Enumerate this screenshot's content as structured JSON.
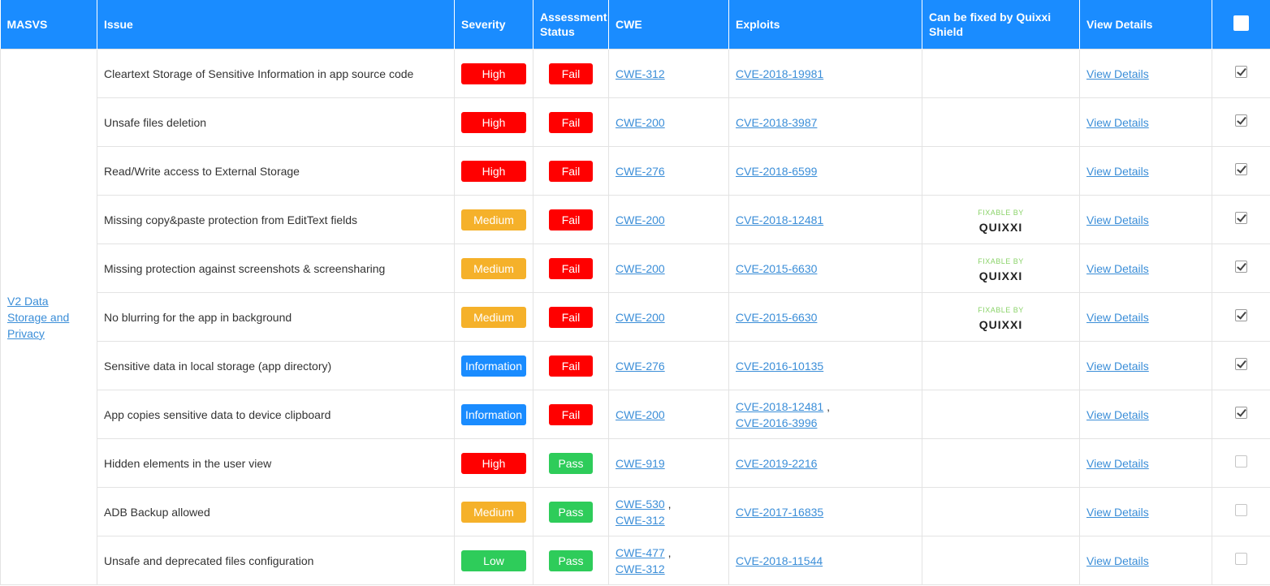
{
  "headers": {
    "masvs": "MASVS",
    "issue": "Issue",
    "severity": "Severity",
    "assessment_status": "Assessment Status",
    "cwe": "CWE",
    "exploits": "Exploits",
    "fixable": "Can be fixed by Quixxi Shield",
    "view_details": "View Details"
  },
  "masvs_group": "V2 Data Storage and Privacy",
  "fixable_label": {
    "top": "FIXABLE BY",
    "brand": "QUIXXI"
  },
  "view_details_label": "View Details",
  "rows": [
    {
      "issue": "Cleartext Storage of Sensitive Information in app source code",
      "severity": "High",
      "status": "Fail",
      "cwe": [
        "CWE-312"
      ],
      "exploits": [
        "CVE-2018-19981"
      ],
      "fixable": false,
      "checked": true
    },
    {
      "issue": "Unsafe files deletion",
      "severity": "High",
      "status": "Fail",
      "cwe": [
        "CWE-200"
      ],
      "exploits": [
        "CVE-2018-3987"
      ],
      "fixable": false,
      "checked": true
    },
    {
      "issue": "Read/Write access to External Storage",
      "severity": "High",
      "status": "Fail",
      "cwe": [
        "CWE-276"
      ],
      "exploits": [
        "CVE-2018-6599"
      ],
      "fixable": false,
      "checked": true
    },
    {
      "issue": "Missing copy&paste protection from EditText fields",
      "severity": "Medium",
      "status": "Fail",
      "cwe": [
        "CWE-200"
      ],
      "exploits": [
        "CVE-2018-12481"
      ],
      "fixable": true,
      "checked": true
    },
    {
      "issue": "Missing protection against screenshots & screensharing",
      "severity": "Medium",
      "status": "Fail",
      "cwe": [
        "CWE-200"
      ],
      "exploits": [
        "CVE-2015-6630"
      ],
      "fixable": true,
      "checked": true
    },
    {
      "issue": "No blurring for the app in background",
      "severity": "Medium",
      "status": "Fail",
      "cwe": [
        "CWE-200"
      ],
      "exploits": [
        "CVE-2015-6630"
      ],
      "fixable": true,
      "checked": true
    },
    {
      "issue": "Sensitive data in local storage (app directory)",
      "severity": "Information",
      "status": "Fail",
      "cwe": [
        "CWE-276"
      ],
      "exploits": [
        "CVE-2016-10135"
      ],
      "fixable": false,
      "checked": true
    },
    {
      "issue": "App copies sensitive data to device clipboard",
      "severity": "Information",
      "status": "Fail",
      "cwe": [
        "CWE-200"
      ],
      "exploits": [
        "CVE-2018-12481",
        "CVE-2016-3996"
      ],
      "fixable": false,
      "checked": true
    },
    {
      "issue": "Hidden elements in the user view",
      "severity": "High",
      "status": "Pass",
      "cwe": [
        "CWE-919"
      ],
      "exploits": [
        "CVE-2019-2216"
      ],
      "fixable": false,
      "checked": false
    },
    {
      "issue": "ADB Backup allowed",
      "severity": "Medium",
      "status": "Pass",
      "cwe": [
        "CWE-530",
        "CWE-312"
      ],
      "exploits": [
        "CVE-2017-16835"
      ],
      "fixable": false,
      "checked": false
    },
    {
      "issue": "Unsafe and deprecated files configuration",
      "severity": "Low",
      "status": "Pass",
      "cwe": [
        "CWE-477",
        "CWE-312"
      ],
      "exploits": [
        "CVE-2018-11544"
      ],
      "fixable": false,
      "checked": false
    }
  ]
}
